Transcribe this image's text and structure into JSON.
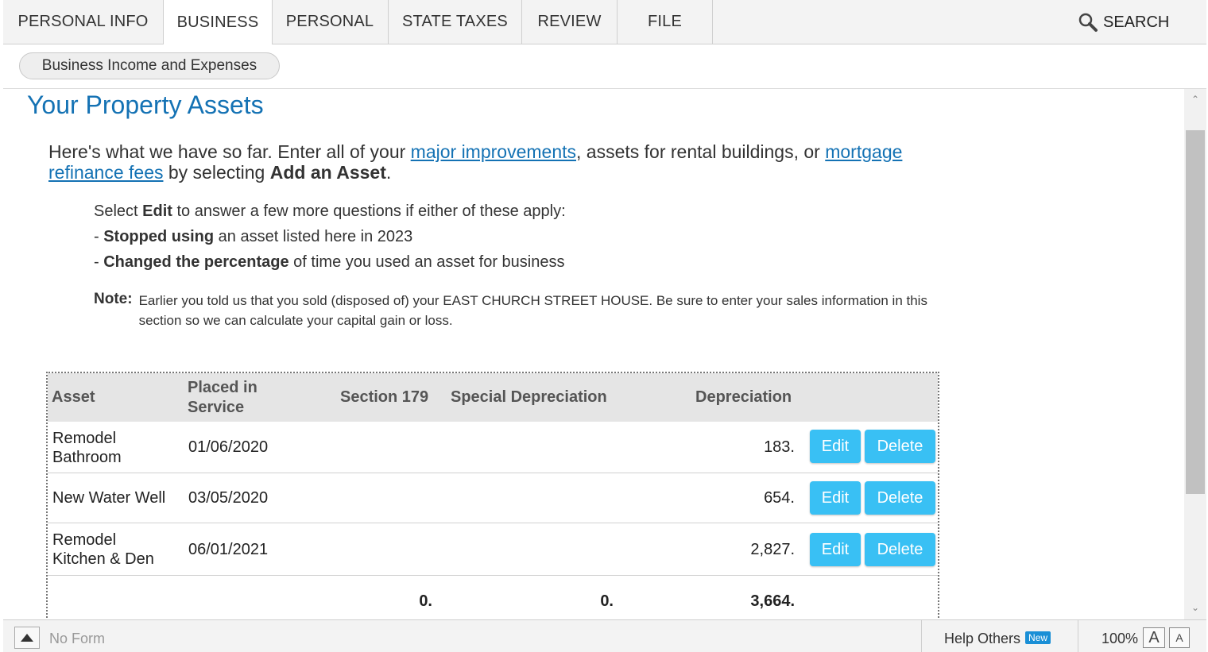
{
  "nav": {
    "tabs": [
      "PERSONAL INFO",
      "BUSINESS",
      "PERSONAL",
      "STATE TAXES",
      "REVIEW",
      "FILE"
    ],
    "active_tab": "BUSINESS",
    "search_label": "SEARCH"
  },
  "subnav": {
    "pill_label": "Business Income and Expenses"
  },
  "page": {
    "title": "Your Property Assets",
    "intro_1": "Here's what we have so far. Enter all of your ",
    "link_1": "major improvements",
    "intro_2": ", assets for rental buildings, or ",
    "link_2": "mortgage refinance fees",
    "intro_3": " by selecting ",
    "intro_bold": "Add an Asset",
    "intro_end": ".",
    "select_pre": "Select ",
    "select_bold": "Edit",
    "select_post": " to answer a few more questions if either of these apply:",
    "bullet1_pre": "- ",
    "bullet1_bold": "Stopped using",
    "bullet1_post": " an asset listed here in 2023",
    "bullet2_pre": "- ",
    "bullet2_bold": "Changed the percentage",
    "bullet2_post": " of time you used an asset for business",
    "note_label": "Note:",
    "note_text": "Earlier you told us that you sold (disposed of) your EAST CHURCH STREET HOUSE. Be sure to enter your sales information in this section so we can calculate your capital gain or loss."
  },
  "table": {
    "headers": {
      "asset": "Asset",
      "placed_1": "Placed in",
      "placed_2": "Service",
      "section179": "Section 179",
      "special": "Special Depreciation",
      "depreciation": "Depreciation"
    },
    "rows": [
      {
        "asset_1": "Remodel",
        "asset_2": "Bathroom",
        "date": "01/06/2020",
        "depreciation": "183.",
        "edit": "Edit",
        "delete": "Delete"
      },
      {
        "asset_1": "New Water Well",
        "asset_2": "",
        "date": "03/05/2020",
        "depreciation": "654.",
        "edit": "Edit",
        "delete": "Delete"
      },
      {
        "asset_1": "Remodel",
        "asset_2": "Kitchen & Den",
        "date": "06/01/2021",
        "depreciation": "2,827.",
        "edit": "Edit",
        "delete": "Delete"
      }
    ],
    "totals": {
      "section179": "0.",
      "special": "0.",
      "depreciation": "3,664."
    }
  },
  "footer": {
    "no_form": "No Form",
    "help_others": "Help Others",
    "new_badge": "New",
    "zoom": "100%",
    "font_large": "A",
    "font_small": "A"
  },
  "colors": {
    "accent": "#1472b4",
    "button": "#39c0f4"
  }
}
